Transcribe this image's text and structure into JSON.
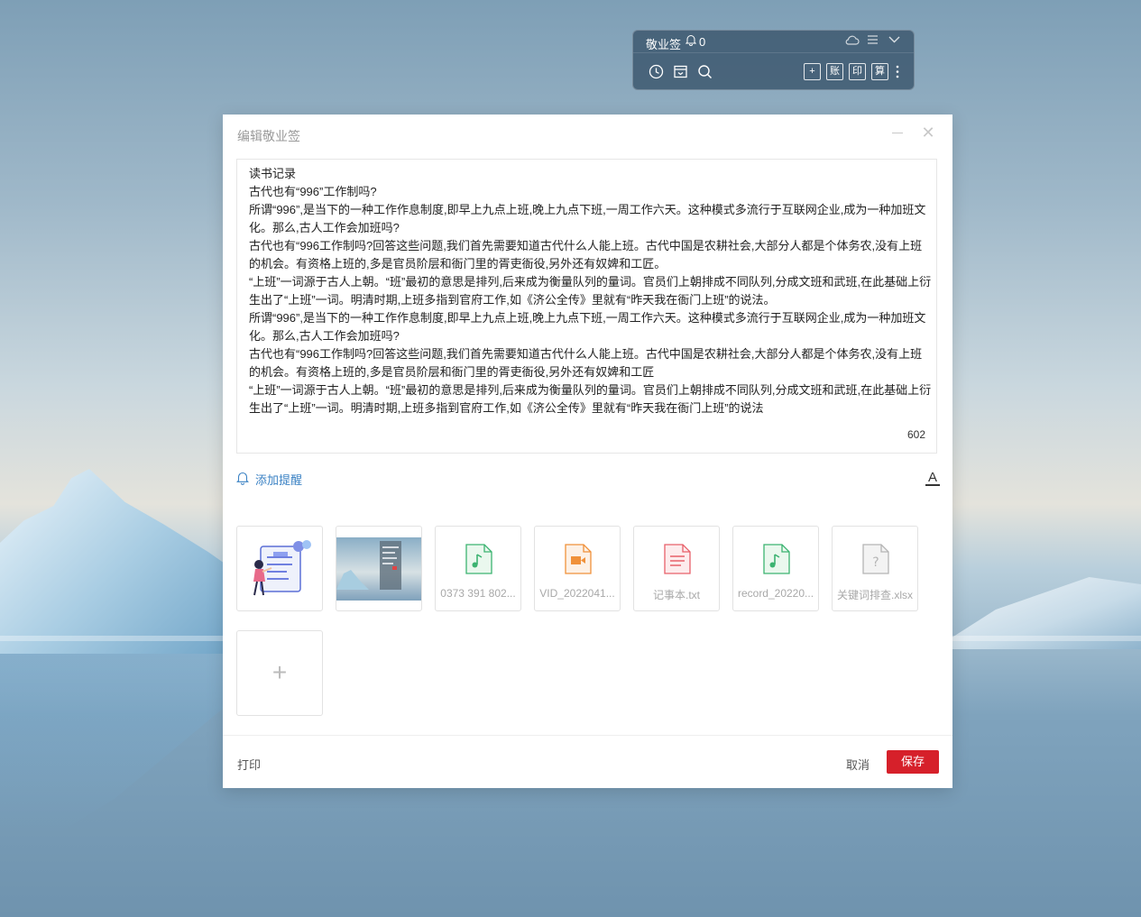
{
  "widget": {
    "title": "敬业签",
    "reminder_count": "0",
    "bottom_buttons": [
      "账",
      "印",
      "算"
    ]
  },
  "dialog": {
    "title": "编辑敬业签",
    "content_lines": [
      "读书记录",
      "古代也有“996”工作制吗?",
      "所谓“996”,是当下的一种工作作息制度,即早上九点上班,晚上九点下班,一周工作六天。这种模式多流行于互联网企业,成为一种加班文化。那么,古人工作会加班吗?",
      "古代也有“996工作制吗?回答这些问题,我们首先需要知道古代什么人能上班。古代中国是农耕社会,大部分人都是个体务农,没有上班的机会。有资格上班的,多是官员阶层和衙门里的胥吏衙役,另外还有奴婢和工匠。",
      "“上班”一词源于古人上朝。“班”最初的意思是排列,后来成为衡量队列的量词。官员们上朝排成不同队列,分成文班和武班,在此基础上衍生出了“上班”一词。明清时期,上班多指到官府工作,如《济公全传》里就有“昨天我在衙门上班”的说法。",
      "所谓“996”,是当下的一种工作作息制度,即早上九点上班,晚上九点下班,一周工作六天。这种模式多流行于互联网企业,成为一种加班文化。那么,古人工作会加班吗?",
      "古代也有“996工作制吗?回答这些问题,我们首先需要知道古代什么人能上班。古代中国是农耕社会,大部分人都是个体务农,没有上班的机会。有资格上班的,多是官员阶层和衙门里的胥吏衙役,另外还有奴婢和工匠",
      "“上班”一词源于古人上朝。“班”最初的意思是排列,后来成为衡量队列的量词。官员们上朝排成不同队列,分成文班和武班,在此基础上衍生出了“上班”一词。明清时期,上班多指到官府工作,如《济公全传》里就有“昨天我在衙门上班”的说法"
    ],
    "char_count": "602",
    "add_reminder_label": "添加提醒",
    "attachments": [
      {
        "type": "image",
        "name": ""
      },
      {
        "type": "image",
        "name": ""
      },
      {
        "type": "audio",
        "name": "0373 391 802...",
        "color": "#3cb371"
      },
      {
        "type": "video",
        "name": "VID_2022041...",
        "color": "#f0913a"
      },
      {
        "type": "text",
        "name": "记事本.txt",
        "color": "#e8606a"
      },
      {
        "type": "audio",
        "name": "record_20220...",
        "color": "#3cb371"
      },
      {
        "type": "unknown",
        "name": "关键词排查.xlsx",
        "color": "#b5b5b5"
      }
    ],
    "add_attachment_symbol": "+",
    "print_label": "打印",
    "cancel_label": "取消",
    "save_label": "保存"
  }
}
